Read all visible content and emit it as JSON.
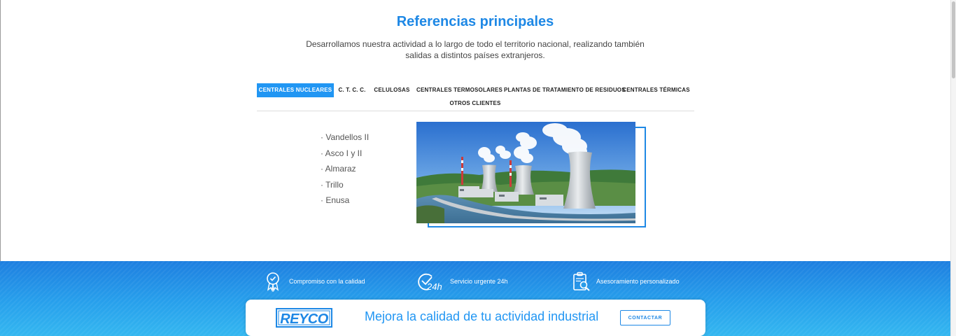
{
  "section": {
    "title": "Referencias principales",
    "intro": "Desarrollamos nuestra actividad a lo largo de todo el territorio nacional, realizando también salidas a distintos países extranjeros."
  },
  "tabs": [
    {
      "label": "CENTRALES NUCLEARES",
      "active": true
    },
    {
      "label": "C. T. C. C.",
      "active": false
    },
    {
      "label": "CELULOSAS",
      "active": false
    },
    {
      "label": "CENTRALES TERMOSOLARES",
      "active": false
    },
    {
      "label": "PLANTAS DE TRATAMIENTO DE RESIDUOS",
      "active": false
    },
    {
      "label": "CENTRALES TÉRMICAS",
      "active": false
    },
    {
      "label": "OTROS CLIENTES",
      "active": false
    }
  ],
  "clients": [
    "· Vandellos II",
    "· Asco I y II",
    "· Almaraz",
    "· Trillo",
    "· Enusa"
  ],
  "photo": {
    "icon": "nuclear-plant-photo"
  },
  "features": [
    {
      "icon": "quality-ribbon-icon",
      "label": "Compromiso con la calidad"
    },
    {
      "icon": "clock-24h-icon",
      "label": "Servicio urgente 24h"
    },
    {
      "icon": "clipboard-search-icon",
      "label": "Asesoramiento personalizado"
    }
  ],
  "cta": {
    "logo_text": "REYCO",
    "text": "Mejora la calidad de tu actividad industrial",
    "button": "CONTACTAR"
  },
  "colors": {
    "accent": "#1e88e5",
    "tab_active": "#2196f3",
    "band_top": "#1e7fe0",
    "band_bottom": "#34b7f0"
  }
}
